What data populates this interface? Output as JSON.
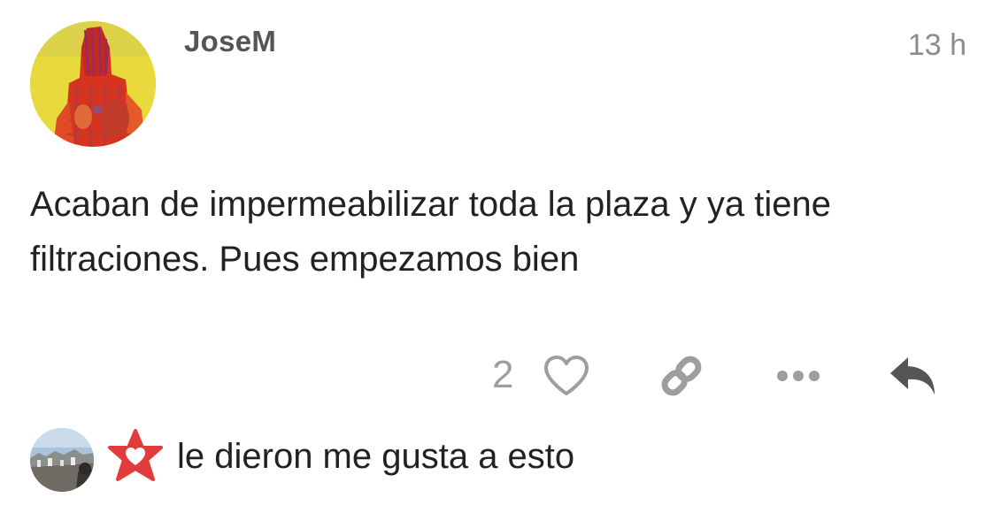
{
  "post": {
    "author": "JoseM",
    "timestamp": "13 h",
    "body": "Acaban de impermeabilizar toda la plaza y ya tiene filtraciones. Pues empezamos bien",
    "like_count": "2"
  },
  "icons": {
    "like": "heart-outline-icon",
    "link": "link-icon",
    "more": "ellipsis-icon",
    "reply": "reply-arrow-icon",
    "badge": "star-heart-badge-icon"
  },
  "likers": {
    "text": "le dieron me gusta a esto"
  },
  "colors": {
    "icon_gray": "#9e9e9e",
    "reply_dark": "#555555",
    "badge_red": "#e23b3b",
    "author_gray": "#555555",
    "timestamp_gray": "#8c8c8c"
  }
}
